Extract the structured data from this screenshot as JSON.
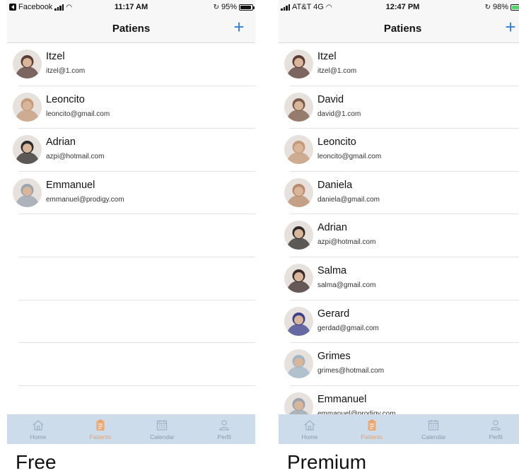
{
  "free": {
    "status": {
      "carrier": "Facebook",
      "time": "11:17 AM",
      "battery": "95%"
    },
    "nav": {
      "title": "Patiens"
    },
    "patients": [
      {
        "name": "Itzel",
        "email": "itzel@1.com",
        "avatar": "#5a3b36"
      },
      {
        "name": "Leoncito",
        "email": "leoncito@gmail.com",
        "avatar": "#c49a7a"
      },
      {
        "name": "Adrian",
        "email": "azpi@hotmail.com",
        "avatar": "#2c2a2a"
      },
      {
        "name": "Emmanuel",
        "email": "emmanuel@prodigy.com",
        "avatar": "#9aa3b0"
      }
    ],
    "tabs": [
      {
        "label": "Home",
        "icon": "home-icon"
      },
      {
        "label": "Patients",
        "icon": "clipboard-icon"
      },
      {
        "label": "Calendar",
        "icon": "calendar-icon"
      },
      {
        "label": "Perfil",
        "icon": "user-icon"
      }
    ]
  },
  "premium": {
    "status": {
      "carrier": "AT&T 4G",
      "time": "12:47 PM",
      "battery": "98%"
    },
    "nav": {
      "title": "Patiens"
    },
    "patients": [
      {
        "name": "Itzel",
        "email": "itzel@1.com",
        "avatar": "#5a3b36"
      },
      {
        "name": "David",
        "email": "david@1.com",
        "avatar": "#7a5a48"
      },
      {
        "name": "Leoncito",
        "email": "leoncito@gmail.com",
        "avatar": "#c49a7a"
      },
      {
        "name": "Daniela",
        "email": "daniela@gmail.com",
        "avatar": "#b8896b"
      },
      {
        "name": "Adrian",
        "email": "azpi@hotmail.com",
        "avatar": "#2c2a2a"
      },
      {
        "name": "Salma",
        "email": "salma@gmail.com",
        "avatar": "#3a2a2a"
      },
      {
        "name": "Gerard",
        "email": "gerdad@gmail.com",
        "avatar": "#3b3f8f"
      },
      {
        "name": "Grimes",
        "email": "grimes@hotmail.com",
        "avatar": "#9fb6c8"
      },
      {
        "name": "Emmanuel",
        "email": "emmanuel@prodigy.com",
        "avatar": "#9aa3b0"
      }
    ],
    "tabs": [
      {
        "label": "Home",
        "icon": "home-icon"
      },
      {
        "label": "Patients",
        "icon": "clipboard-icon"
      },
      {
        "label": "Calendar",
        "icon": "calendar-icon"
      },
      {
        "label": "Perfil",
        "icon": "user-icon"
      }
    ]
  },
  "captions": {
    "free": "Free",
    "premium": "Premium"
  },
  "colors": {
    "accent": "#2f7fd9",
    "tab_active": "#f0a060",
    "tabbar_bg": "#cddcea"
  }
}
